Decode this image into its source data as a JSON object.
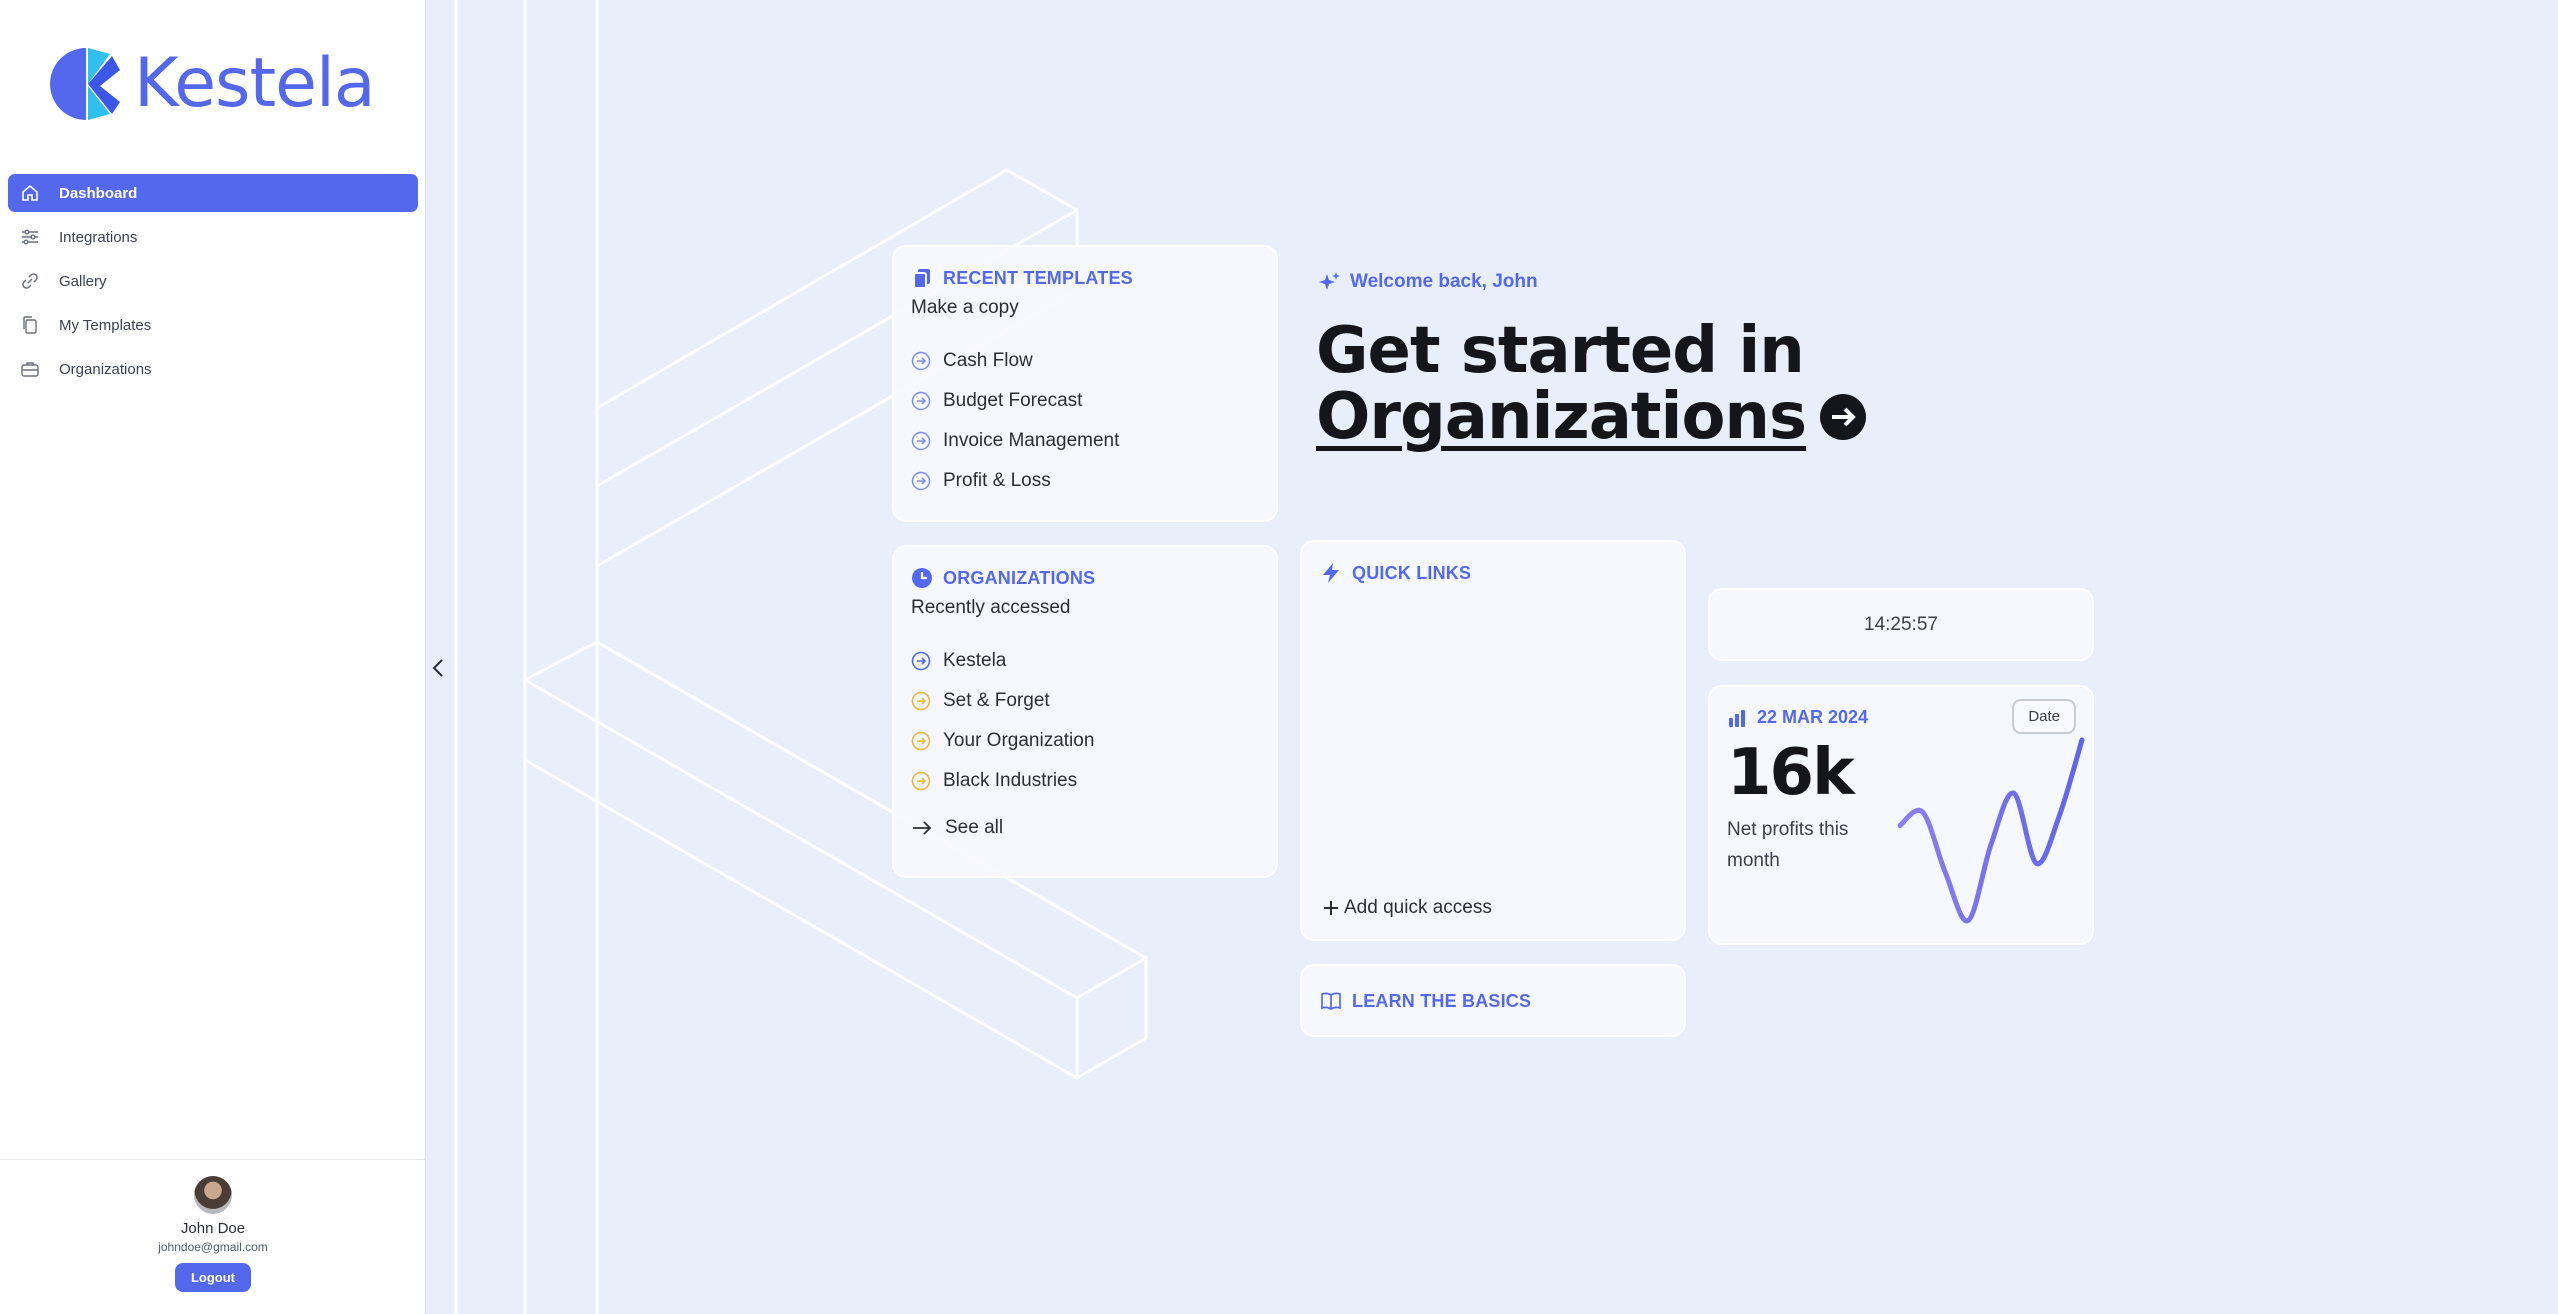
{
  "brand": {
    "name": "Kestela",
    "accent": "#5468ee"
  },
  "sidebar": {
    "items": [
      {
        "label": "Dashboard",
        "icon": "home-icon",
        "active": true
      },
      {
        "label": "Integrations",
        "icon": "sliders-icon",
        "active": false
      },
      {
        "label": "Gallery",
        "icon": "link-icon",
        "active": false
      },
      {
        "label": "My Templates",
        "icon": "copy-icon",
        "active": false
      },
      {
        "label": "Organizations",
        "icon": "briefcase-icon",
        "active": false
      }
    ],
    "user": {
      "name": "John Doe",
      "email": "johndoe@gmail.com",
      "logout_label": "Logout"
    }
  },
  "templates": {
    "title": "RECENT TEMPLATES",
    "subtitle": "Make a copy",
    "items": [
      "Cash Flow",
      "Budget Forecast",
      "Invoice Management",
      "Profit & Loss"
    ]
  },
  "organizations": {
    "title": "ORGANIZATIONS",
    "subtitle": "Recently accessed",
    "items": [
      {
        "label": "Kestela",
        "color": "#5468ee"
      },
      {
        "label": "Set & Forget",
        "color": "#f0b640"
      },
      {
        "label": "Your Organization",
        "color": "#f0b640"
      },
      {
        "label": "Black Industries",
        "color": "#f0b640"
      }
    ],
    "see_all_label": "See all"
  },
  "hero": {
    "welcome": "Welcome back, John",
    "headline_line1": "Get started in",
    "headline_link": "Organizations"
  },
  "quick_links": {
    "title": "QUICK LINKS",
    "add_label": "Add quick access"
  },
  "basics": {
    "title": "LEARN THE BASICS"
  },
  "clock": {
    "time": "14:25:57"
  },
  "profit": {
    "date": "22 MAR 2024",
    "date_button": "Date",
    "value": "16k",
    "label": "Net profits this month",
    "trend": [
      0.55,
      0.62,
      0.3,
      0.05,
      0.45,
      0.72,
      0.35,
      0.6,
      1.0
    ]
  }
}
